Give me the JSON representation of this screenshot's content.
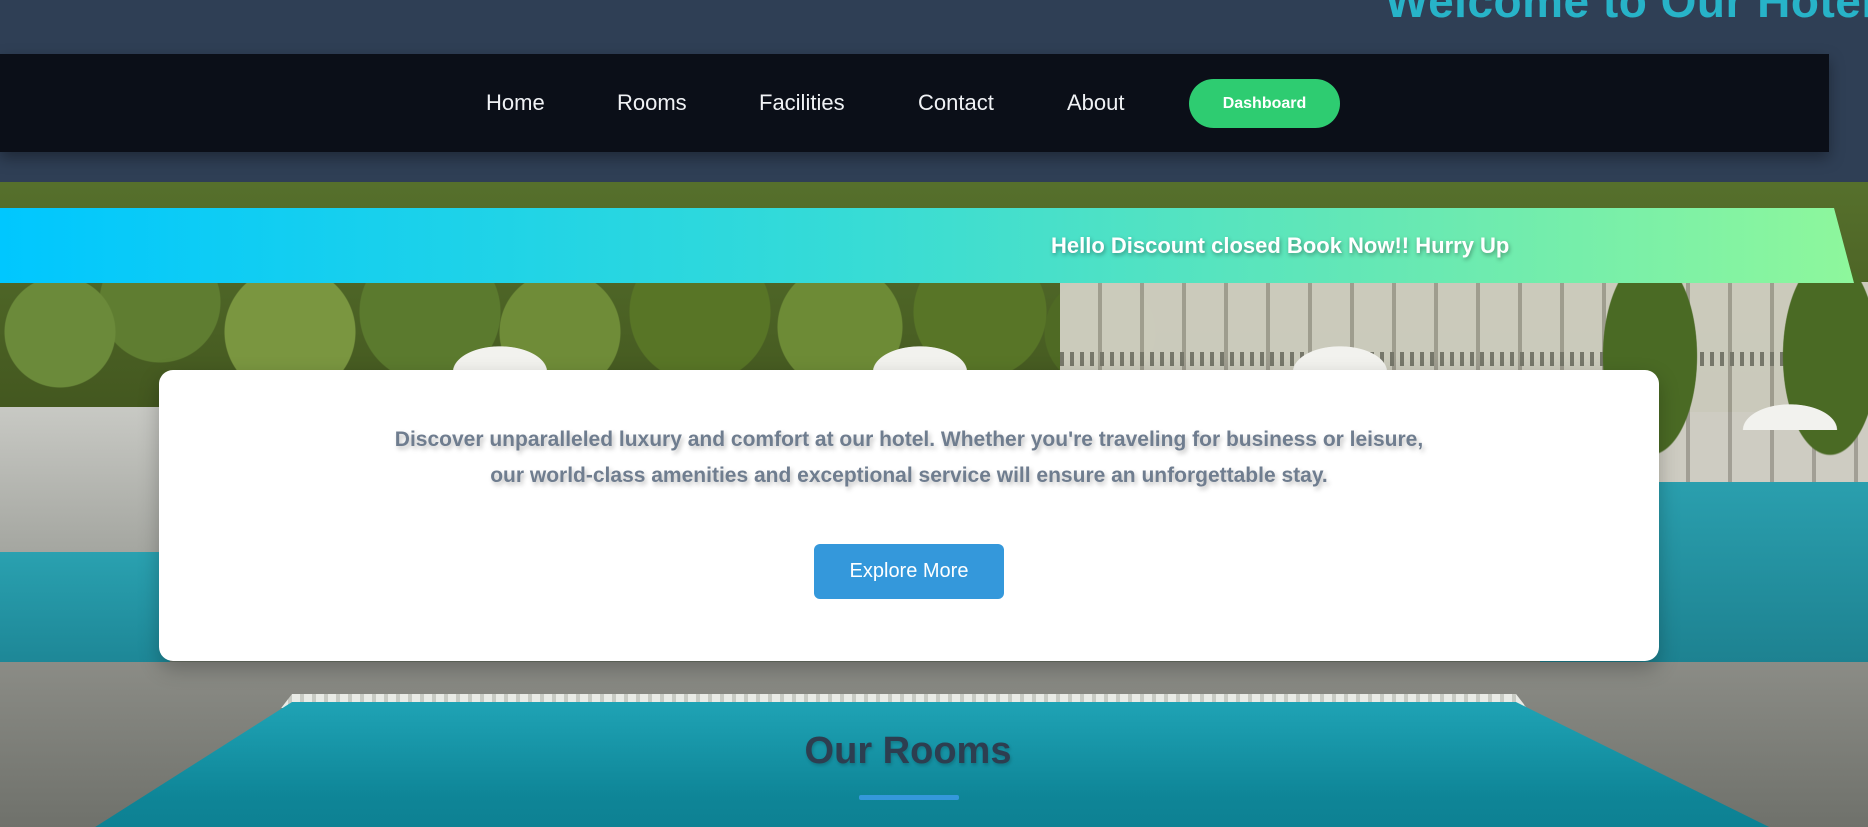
{
  "header": {
    "welcome_title": "Welcome to Our Hotel"
  },
  "nav": {
    "items": [
      {
        "label": "Home"
      },
      {
        "label": "Rooms"
      },
      {
        "label": "Facilities"
      },
      {
        "label": "Contact"
      },
      {
        "label": "About"
      }
    ],
    "dashboard_label": "Dashboard"
  },
  "banner": {
    "text": "Hello Discount closed Book Now!! Hurry Up"
  },
  "hero": {
    "description": "Discover unparalleled luxury and comfort at our hotel. Whether you're traveling for business or leisure, our world-class amenities and exceptional service will ensure an unforgettable stay.",
    "cta_label": "Explore More"
  },
  "rooms_section": {
    "heading": "Our Rooms"
  },
  "colors": {
    "navbar_bg": "#0b0f18",
    "page_bg": "#2f3f55",
    "dashboard_green": "#2ecc71",
    "cta_blue": "#3498db",
    "title_teal": "#27b3c8"
  }
}
